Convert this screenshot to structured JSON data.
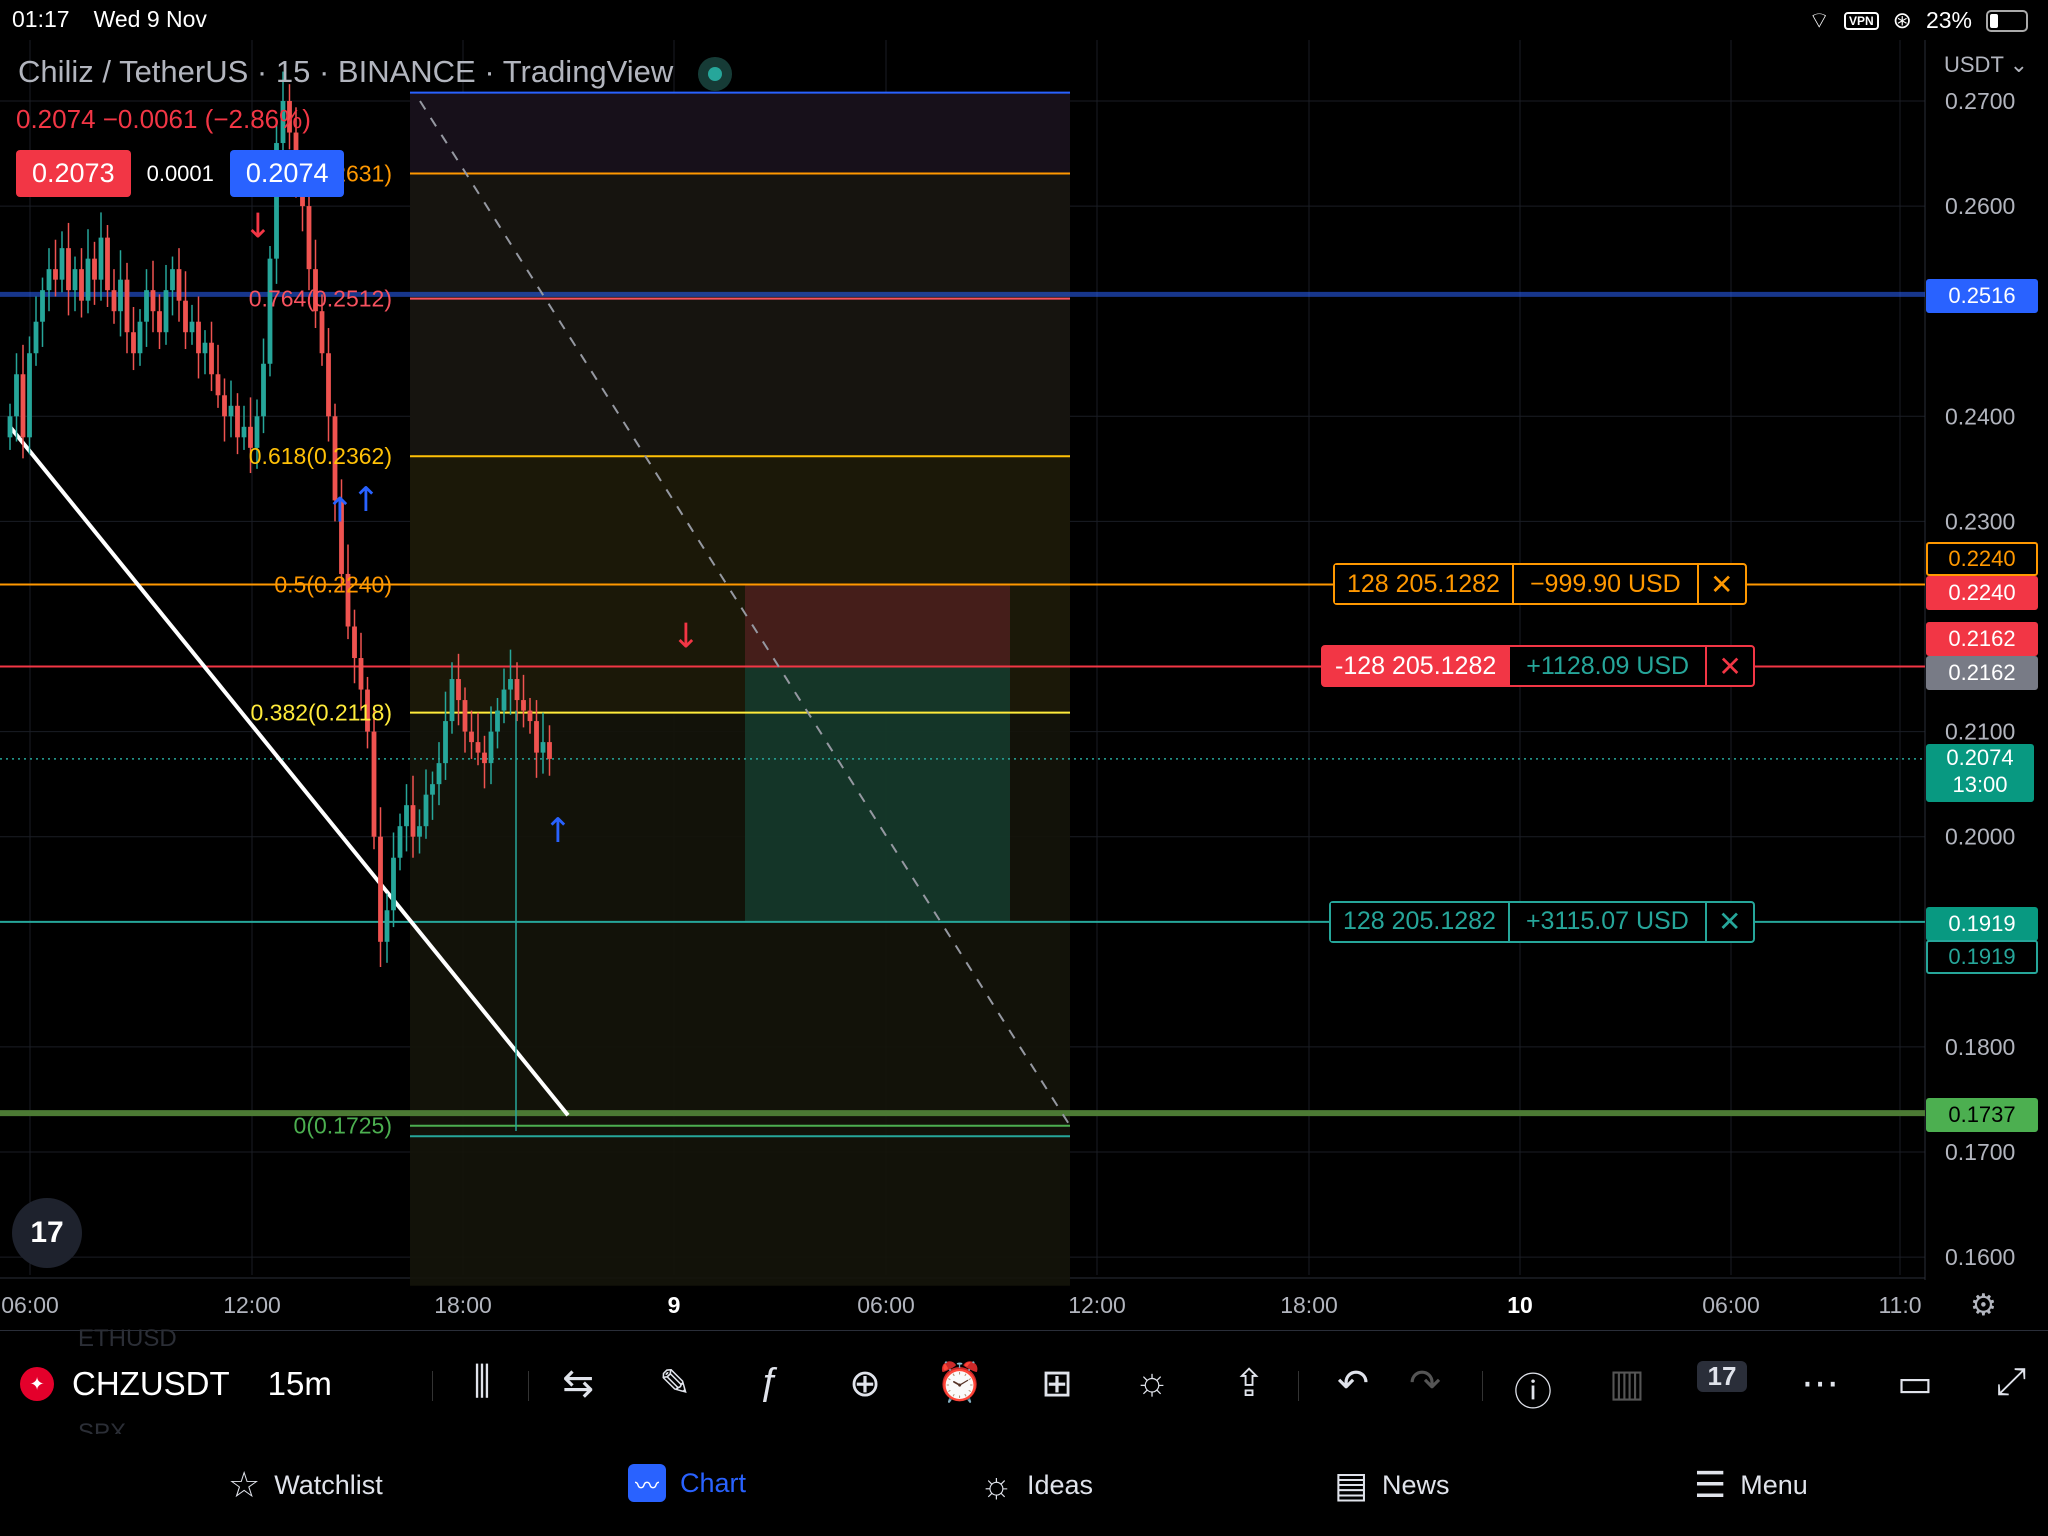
{
  "status": {
    "time": "01:17",
    "date": "Wed 9 Nov",
    "vpn": "VPN",
    "battery": "23%"
  },
  "header": {
    "pair": "Chiliz / TetherUS",
    "interval": "15",
    "exchange": "BINANCE",
    "source": "TradingView",
    "ohlc": "0.2074 −0.0061 (−2.86%)",
    "bid": "0.2073",
    "spread": "0.0001",
    "ask": "0.2074"
  },
  "axis": {
    "currency": "USDT"
  },
  "price_scale": [
    "0.2700",
    "0.2600",
    "0.2400",
    "0.2300",
    "0.2100",
    "0.2000",
    "0.1800",
    "0.1700",
    "0.1600"
  ],
  "price_labels": [
    {
      "text": "0.2516",
      "value": 0.2516,
      "bg": "#2962ff",
      "fg": "#ffffff",
      "border": "#2962ff"
    },
    {
      "text": "0.2240",
      "value": 0.2266,
      "bg": "#000000",
      "fg": "#ff9800",
      "border": "#ff9800"
    },
    {
      "text": "0.2240",
      "value": 0.2234,
      "bg": "#f23645",
      "fg": "#ffffff",
      "border": "#f23645"
    },
    {
      "text": "0.2162",
      "value": 0.219,
      "bg": "#f23645",
      "fg": "#ffffff",
      "border": "#f23645"
    },
    {
      "text": "0.2162",
      "value": 0.2158,
      "bg": "#787b86",
      "fg": "#ffffff",
      "border": "#787b86"
    },
    {
      "text": "0.1919",
      "value": 0.1919,
      "bg": "#089981",
      "fg": "#ffffff",
      "border": "#089981"
    },
    {
      "text": "0.1919",
      "value": 0.1887,
      "bg": "#000000",
      "fg": "#26a69a",
      "border": "#26a69a"
    },
    {
      "text": "0.1737",
      "value": 0.1737,
      "bg": "#4caf50",
      "fg": "#000000",
      "border": "#4caf50"
    }
  ],
  "last_price": {
    "price": "0.2074",
    "countdown": "13:00",
    "value": 0.2074
  },
  "time_labels": [
    "06:00",
    "12:00",
    "18:00",
    "9",
    "06:00",
    "12:00",
    "18:00",
    "10",
    "06:00",
    "11:0"
  ],
  "fib_levels": [
    {
      "label": "0.786(0.2631)",
      "value": 0.2631,
      "color": "#ff9800"
    },
    {
      "label": "0.764(0.2512)",
      "value": 0.2512,
      "color": "#f7525f"
    },
    {
      "label": "0.618(0.2362)",
      "value": 0.2362,
      "color": "#ffc107"
    },
    {
      "label": "0.5(0.2240)",
      "value": 0.224,
      "color": "#ff9800"
    },
    {
      "label": "0.382(0.2118)",
      "value": 0.2118,
      "color": "#ffeb3b"
    },
    {
      "label": "0(0.1725)",
      "value": 0.1725,
      "color": "#4caf50"
    }
  ],
  "positions": [
    {
      "qty": "128 205.1282",
      "pnl": "−999.90 USD",
      "close": "✕",
      "value": 0.224,
      "type": "stop"
    },
    {
      "qty": "-128 205.1282",
      "pnl": "+1128.09 USD",
      "close": "✕",
      "value": 0.2162,
      "type": "entry"
    },
    {
      "qty": "128 205.1282",
      "pnl": "+3115.07 USD",
      "close": "✕",
      "value": 0.1919,
      "type": "target"
    }
  ],
  "colors": {
    "up": "#26a69a",
    "down": "#ef5350",
    "blue_line": "#2962ff",
    "green_line": "#4c7a34"
  },
  "toolbar": {
    "symbol": "CHZUSDT",
    "interval": "15m",
    "ghost_above": "ETHUSD",
    "ghost_below": "SPX"
  },
  "nav": {
    "watchlist": "Watchlist",
    "chart": "Chart",
    "ideas": "Ideas",
    "news": "News",
    "menu": "Menu"
  }
}
